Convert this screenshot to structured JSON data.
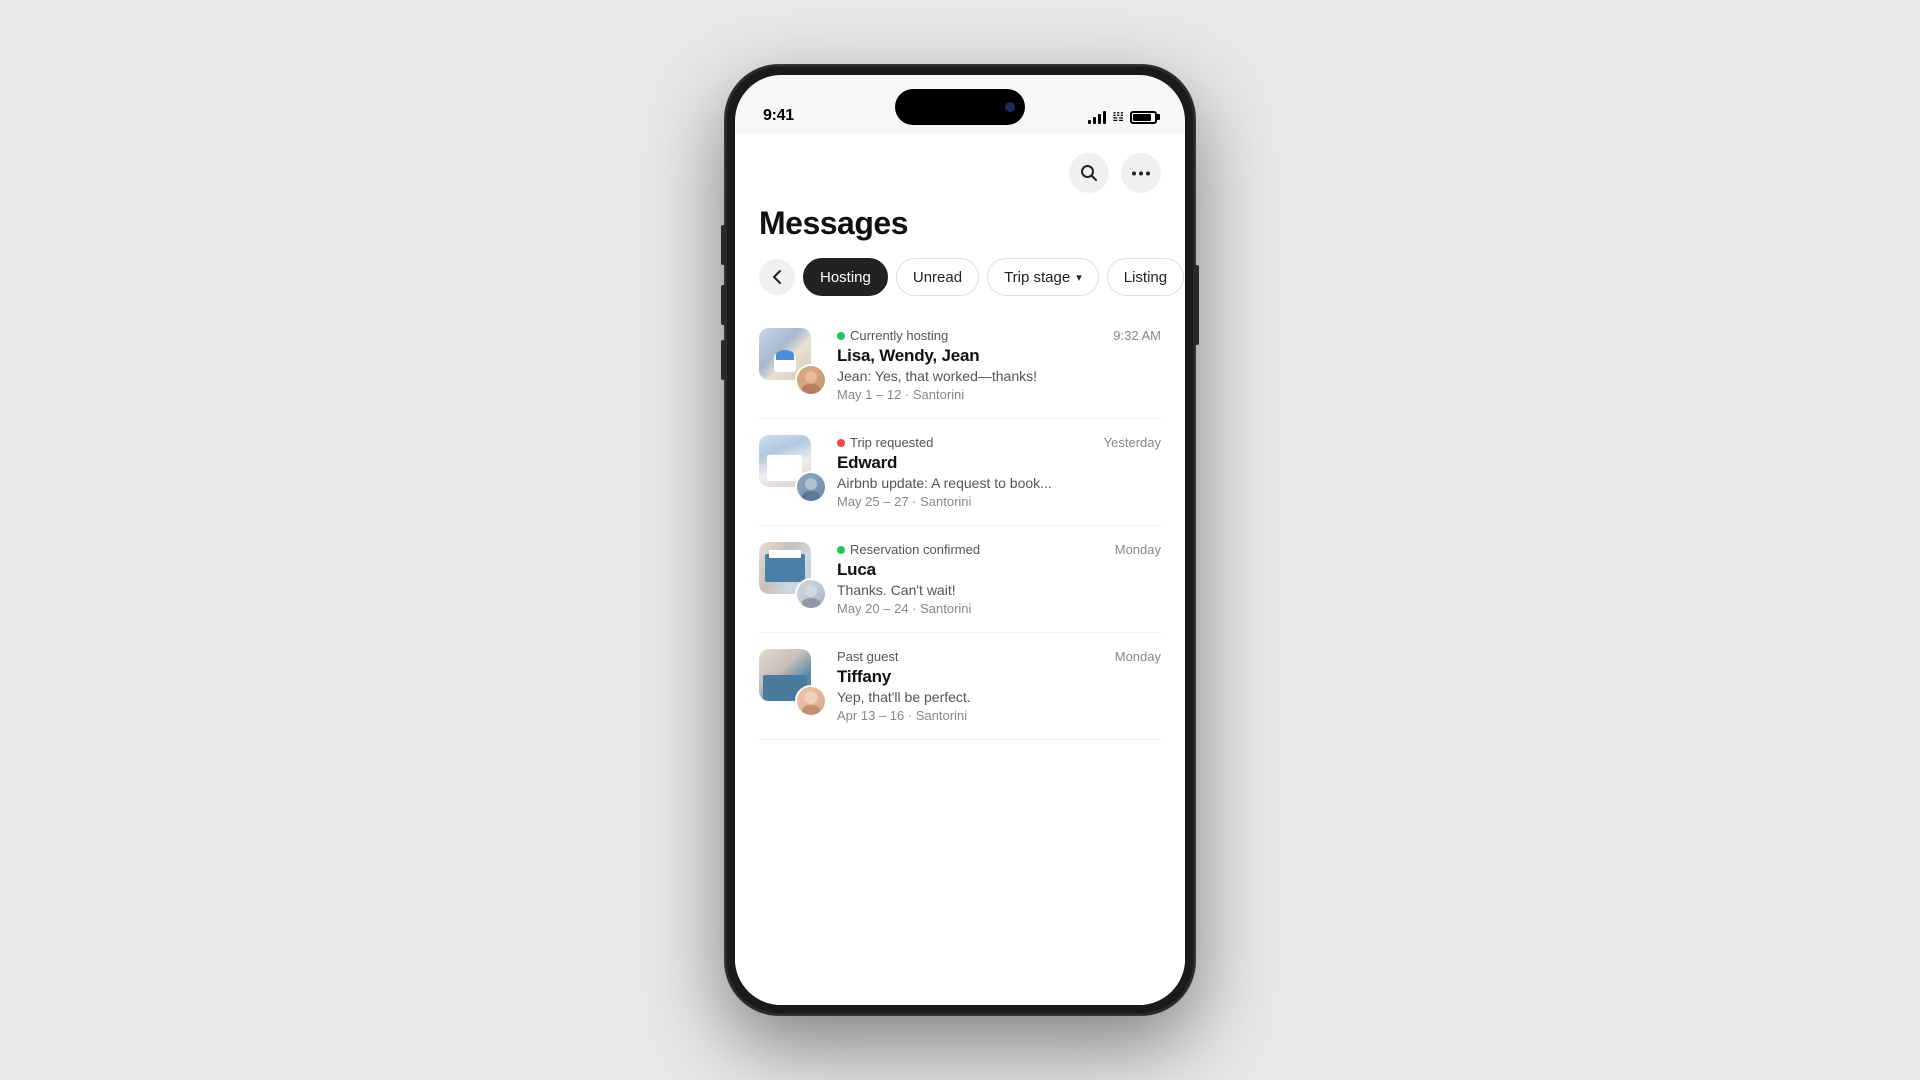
{
  "status_bar": {
    "time": "9:41"
  },
  "header": {
    "search_label": "Search",
    "more_label": "More options"
  },
  "page": {
    "title": "Messages"
  },
  "filters": {
    "back_label": "←",
    "chips": [
      {
        "id": "hosting",
        "label": "Hosting",
        "active": true,
        "has_chevron": false
      },
      {
        "id": "unread",
        "label": "Unread",
        "active": false,
        "has_chevron": false
      },
      {
        "id": "trip-stage",
        "label": "Trip stage",
        "active": false,
        "has_chevron": true
      },
      {
        "id": "listing",
        "label": "Listing",
        "active": false,
        "has_chevron": false
      }
    ]
  },
  "messages": [
    {
      "id": "msg-1",
      "status_dot": "green",
      "status_label": "Currently hosting",
      "time": "9:32 AM",
      "name": "Lisa, Wendy, Jean",
      "preview": "Jean: Yes, that worked—thanks!",
      "meta": "May 1 – 12 · Santorini",
      "avatar_user_class": "user-jean",
      "avatar_prop_class": "prop-santorini-1"
    },
    {
      "id": "msg-2",
      "status_dot": "red",
      "status_label": "Trip requested",
      "time": "Yesterday",
      "name": "Edward",
      "preview": "Airbnb update: A request to book...",
      "meta": "May 25 – 27 · Santorini",
      "avatar_user_class": "user-edward",
      "avatar_prop_class": "prop-santorini-2"
    },
    {
      "id": "msg-3",
      "status_dot": "green",
      "status_label": "Reservation confirmed",
      "time": "Monday",
      "name": "Luca",
      "preview": "Thanks. Can't wait!",
      "meta": "May 20 – 24 · Santorini",
      "avatar_user_class": "user-luca",
      "avatar_prop_class": "prop-santorini-3"
    },
    {
      "id": "msg-4",
      "status_dot": "none",
      "status_label": "Past guest",
      "time": "Monday",
      "name": "Tiffany",
      "preview": "Yep, that'll be perfect.",
      "meta": "Apr 13 – 16 · Santorini",
      "avatar_user_class": "user-tiffany",
      "avatar_prop_class": "prop-santorini-4"
    }
  ]
}
